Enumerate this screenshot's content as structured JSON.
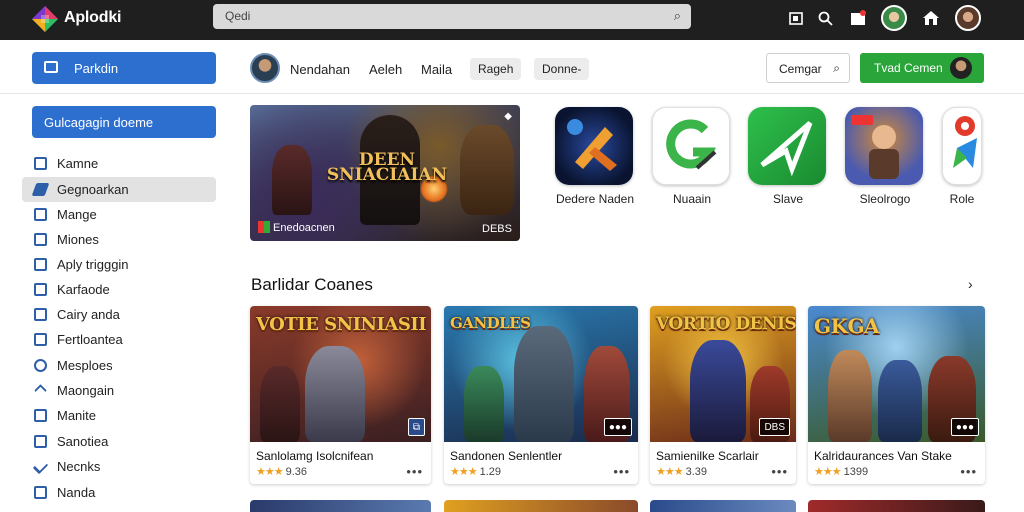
{
  "topbar": {
    "brand": "Aplodki",
    "search_placeholder": "Qedi",
    "icons": [
      "calendar-icon",
      "search-icon",
      "gift-icon",
      "profile-avatar-icon",
      "home-icon",
      "user-avatar-icon"
    ]
  },
  "sidebar": {
    "primary_button": "Parkdin",
    "secondary_button": "Gulcagagin doeme",
    "items": [
      {
        "label": "Kamne",
        "icon": "folder-icon"
      },
      {
        "label": "Gegnoarkan",
        "icon": "pencil-icon",
        "active": true
      },
      {
        "label": "Mange",
        "icon": "box-icon"
      },
      {
        "label": "Miones",
        "icon": "home-icon"
      },
      {
        "label": "Aply trigggin",
        "icon": "square-icon"
      },
      {
        "label": "Karfaode",
        "icon": "square-icon"
      },
      {
        "label": "Cairy anda",
        "icon": "square-icon"
      },
      {
        "label": "Fertloantea",
        "icon": "square-icon"
      },
      {
        "label": "Mesploes",
        "icon": "target-icon"
      },
      {
        "label": "Maongain",
        "icon": "arrow-icon"
      },
      {
        "label": "Manite",
        "icon": "check-box-icon"
      },
      {
        "label": "Sanotiea",
        "icon": "box-icon"
      },
      {
        "label": "Necnks",
        "icon": "check-icon"
      },
      {
        "label": "Nanda",
        "icon": "square-icon"
      }
    ]
  },
  "header": {
    "nav": [
      "Nendahan",
      "Aeleh",
      "Maila"
    ],
    "chips": [
      "Rageh",
      "Donne-"
    ],
    "compare_button": "Cemgar",
    "green_button": "Tvad Cemen"
  },
  "hero": {
    "title": "DEEN SNIACIAIAN",
    "caption": "Enedoacnen",
    "badge": "DEBS"
  },
  "apps": [
    {
      "label": "Dedere Naden",
      "colors": [
        "#1a2a5a",
        "#f0a030"
      ]
    },
    {
      "label": "Nuaain",
      "colors": [
        "#ffffff",
        "#3bb44a"
      ]
    },
    {
      "label": "Slave",
      "colors": [
        "#1f9a3a",
        "#2ec04c"
      ]
    },
    {
      "label": "Sleolrogo",
      "colors": [
        "#4a5ab0",
        "#d08a3a"
      ]
    },
    {
      "label": "Role",
      "colors": [
        "#ffffff",
        "#e33b2b"
      ]
    }
  ],
  "section": {
    "title": "Barlidar Coanes"
  },
  "games": [
    {
      "art_title": "VOTIE SNINIASII",
      "title": "Sanlolamg Isolcnifean",
      "rating": "9.36",
      "badge": "⧉",
      "colors": [
        "#8a3a2a",
        "#3a1f22"
      ]
    },
    {
      "art_title": "GANDLES",
      "title": "Sandonen Senlentler",
      "rating": "1.29",
      "badge": "●●●",
      "colors": [
        "#2a7ab0",
        "#1a2a4a"
      ]
    },
    {
      "art_title": "VORTIO DENIS",
      "title": "Samienilke Scarlair",
      "rating": "3.39",
      "badge": "DBS",
      "colors": [
        "#e0a020",
        "#6a2a1a"
      ]
    },
    {
      "art_title": "GKGA",
      "title": "Kalridaurances Van Stake",
      "rating": "1399",
      "badge": "●●●",
      "colors": [
        "#4a8ad0",
        "#3a5a2a"
      ]
    }
  ]
}
